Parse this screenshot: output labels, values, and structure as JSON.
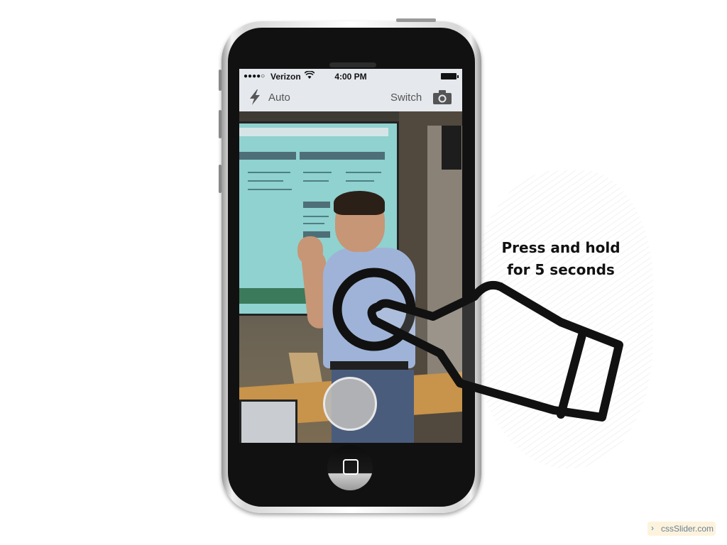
{
  "status_bar": {
    "signal_dots": "●●●●○",
    "carrier": "Verizon",
    "wifi_icon": "wifi-icon",
    "time": "4:00 PM",
    "battery_icon": "battery-icon"
  },
  "camera_toolbar": {
    "flash_icon": "lightning-bolt-icon",
    "flash_label": "Auto",
    "switch_label": "Switch",
    "camera_icon": "camera-icon"
  },
  "shutter": {
    "icon": "shutter-circle"
  },
  "home_button": {
    "icon": "home-square-icon"
  },
  "instruction": {
    "line1": "Press and hold",
    "line2": "for 5 seconds"
  },
  "gesture": {
    "icon": "press-hand-icon"
  },
  "watermark": {
    "chevron": "›",
    "text": "cssSlider.com"
  },
  "colors": {
    "toolbar_bg": "#e5e8ec",
    "phone_bezel": "#111111",
    "instruction_text": "#111111"
  }
}
